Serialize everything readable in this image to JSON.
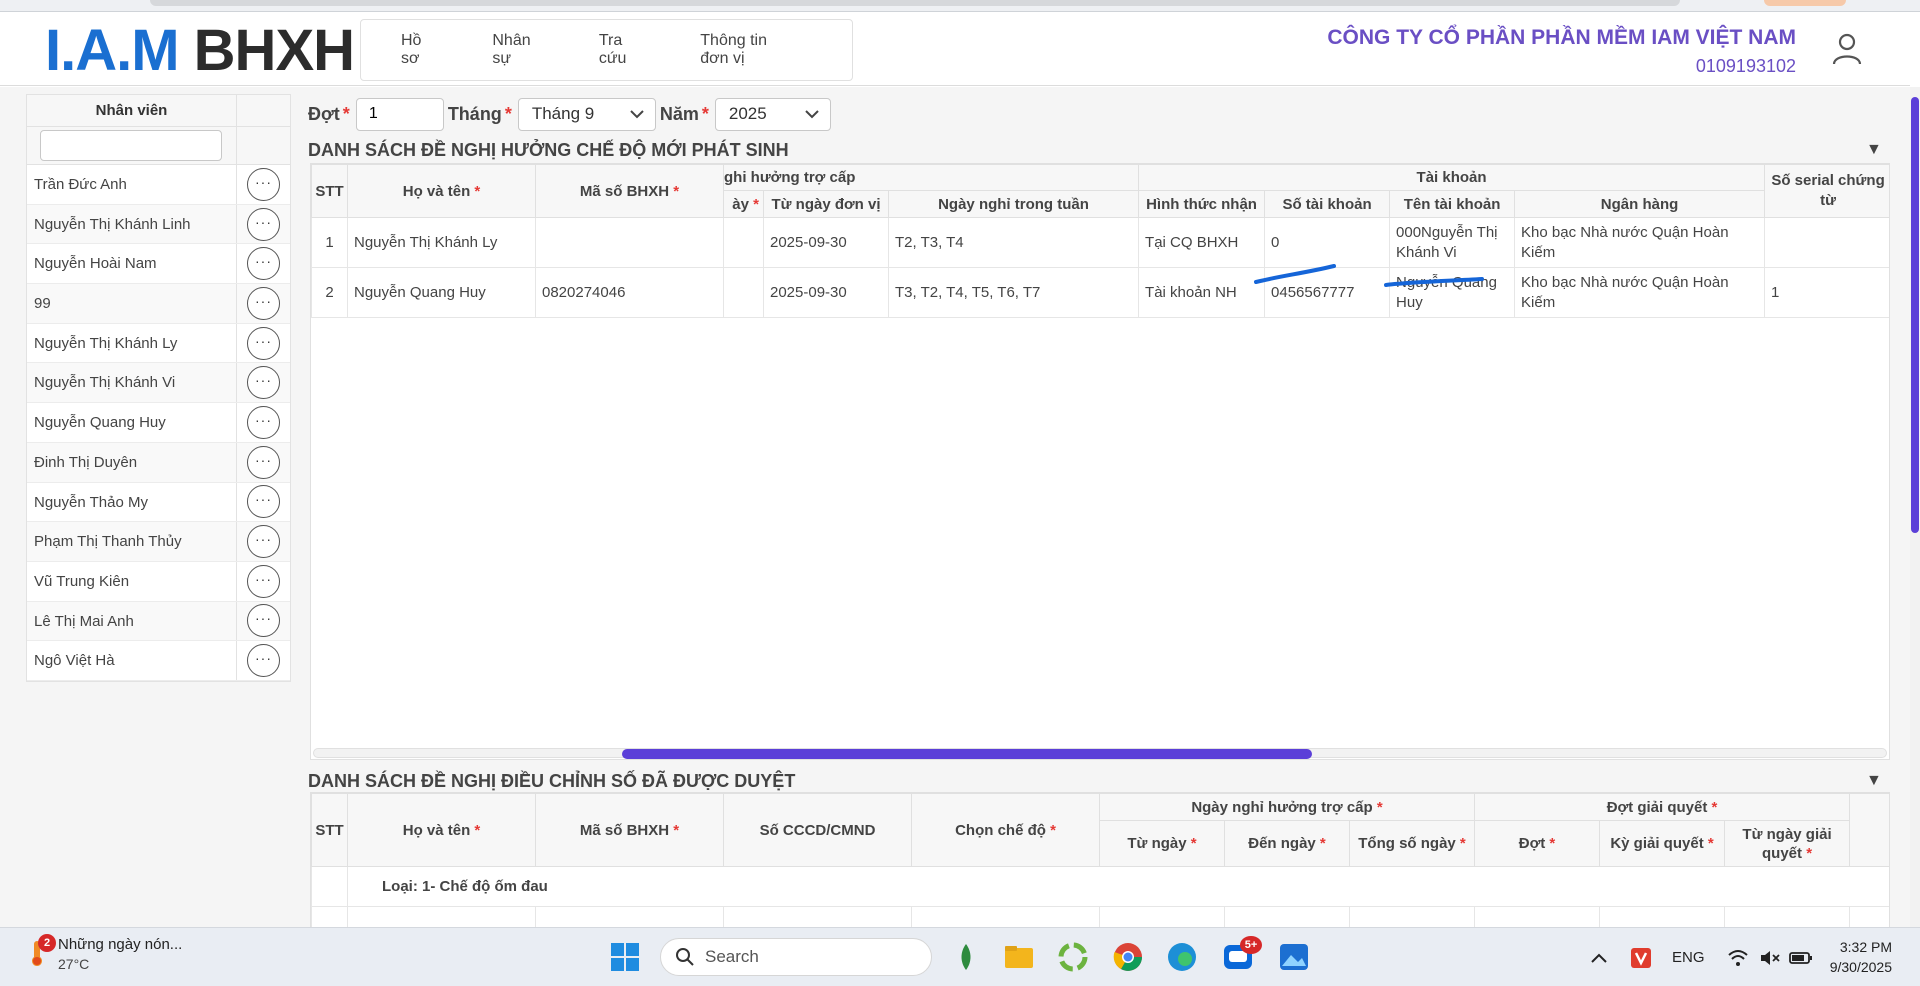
{
  "header": {
    "logo_part1": "I.A.M",
    "logo_part2": "BHXH",
    "nav": [
      "Hồ sơ",
      "Nhân sự",
      "Tra cứu",
      "Thông tin đơn vị"
    ],
    "company_name": "CÔNG TY CỔ PHẦN PHẦN MỀM IAM VIỆT NAM",
    "tax_code": "0109193102"
  },
  "sidebar": {
    "column_header": "Nhân viên",
    "action_label": "···",
    "employees": [
      "Trần Đức Anh",
      "Nguyễn Thị Khánh Linh",
      "Nguyễn Hoài Nam",
      "99",
      "Nguyễn Thị Khánh Ly",
      "Nguyễn Thị Khánh Vi",
      "Nguyễn Quang Huy",
      "Đinh Thị Duyên",
      "Nguyễn Thảo My",
      "Phạm Thị Thanh Thủy",
      "Vũ Trung Kiên",
      "Lê Thị Mai Anh",
      "Ngô Việt Hà"
    ]
  },
  "filters": {
    "dot_label": "Đợt",
    "dot_value": "1",
    "thang_label": "Tháng",
    "thang_value": "Tháng 9",
    "nam_label": "Năm",
    "nam_value": "2025",
    "required_mark": "*"
  },
  "section1": {
    "title": "DANH SÁCH ĐỀ NGHỊ HƯỞNG CHẾ ĐỘ MỚI PHÁT SINH",
    "group_leave": "ghi hưởng trợ cấp",
    "group_account": "Tài khoản",
    "columns": {
      "stt": "STT",
      "name": "Họ và tên",
      "bhxh": "Mã số BHXH",
      "partial": "ày",
      "from_unit": "Từ ngày đơn vị",
      "weekdays": "Ngày nghỉ trong tuần",
      "receive": "Hình thức nhận",
      "acc_no": "Số tài khoản",
      "acc_name": "Tên tài khoản",
      "bank": "Ngân hàng",
      "serial": "Số serial chứng từ"
    },
    "rows": [
      {
        "stt": "1",
        "name": "Nguyễn Thị Khánh Ly",
        "bhxh": "",
        "from_unit": "2025-09-30",
        "weekdays": "T2, T3, T4",
        "receive": "Tại CQ BHXH",
        "acc_no": "0",
        "acc_name": "000Nguyễn Thị Khánh Vi",
        "bank": "Kho bạc Nhà nước Quận Hoàn Kiếm",
        "serial": ""
      },
      {
        "stt": "2",
        "name": "Nguyễn Quang Huy",
        "bhxh": "0820274046",
        "from_unit": "2025-09-30",
        "weekdays": "T3, T2, T4, T5, T6, T7",
        "receive": "Tài khoản NH",
        "acc_no": "0456567777",
        "acc_name": "Nguyễn Quang Huy",
        "bank": "Kho bạc Nhà nước Quận Hoàn Kiếm",
        "serial": "1"
      }
    ]
  },
  "section2": {
    "title": "DANH SÁCH ĐỀ NGHỊ ĐIỀU CHỈNH SỐ ĐÃ ĐƯỢC DUYỆT",
    "group_leave": "Ngày nghỉ hưởng trợ cấp",
    "group_period": "Đợt giải quyết",
    "columns": {
      "stt": "STT",
      "name": "Họ và tên",
      "bhxh": "Mã số BHXH",
      "cccd": "Số CCCD/CMND",
      "regime": "Chọn chế độ",
      "from": "Từ ngày",
      "to": "Đến ngày",
      "total": "Tổng số ngày",
      "dot": "Đợt",
      "ky": "Kỳ giải quyết",
      "from_period": "Từ ngày giải quyết"
    },
    "group_row": "Loại: 1- Chế độ ốm đau"
  },
  "taskbar": {
    "notif_count": "2",
    "news_title": "Những ngày nón...",
    "temperature": "27°C",
    "search_label": "Search",
    "zalo_badge": "5+",
    "lang": "ENG",
    "time": "3:32 PM",
    "date": "9/30/2025"
  },
  "colors": {
    "brand_blue": "#1a6fd1",
    "company_purple": "#6a4fc4",
    "scroll_thumb": "#5b3fd8",
    "required_red": "#e53935",
    "ink_blue": "#1565d8"
  }
}
